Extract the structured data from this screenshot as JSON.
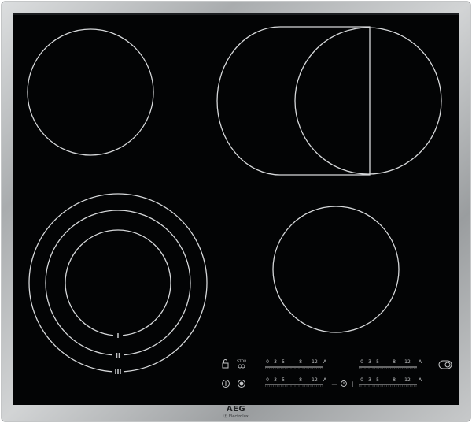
{
  "colors": {
    "frame_light": "#c9cbcc",
    "frame_dark": "#7c7f81",
    "glass": "#030405",
    "zone_outline": "#d6d8da",
    "print": "#c4c6c8"
  },
  "zone_markers": [
    "I",
    "II",
    "III"
  ],
  "controls": {
    "scale": [
      "0",
      "3",
      "5",
      "8",
      "12",
      "A"
    ],
    "stop_label": "STOP",
    "plus": "+",
    "minus": "−"
  },
  "brand": {
    "name": "AEG",
    "sub": "Ⓔ Electrolux"
  }
}
